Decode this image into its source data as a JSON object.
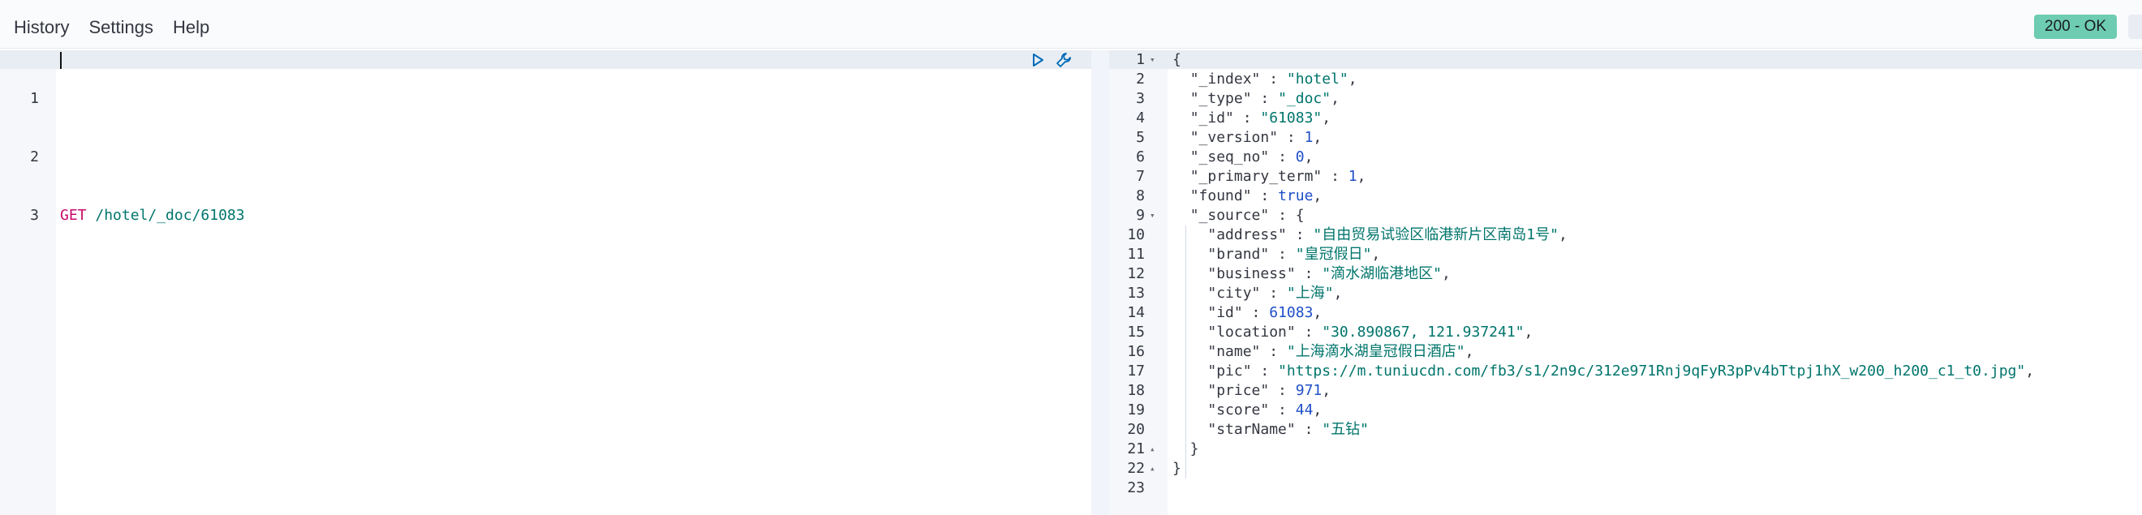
{
  "menu": {
    "history": "History",
    "settings": "Settings",
    "help": "Help"
  },
  "status": "200 - OK",
  "colors": {
    "status_bg": "#6dccb1",
    "method": "#c80a68",
    "string": "#00756c",
    "number": "#1f4fc8",
    "icon": "#006bb8"
  },
  "request": {
    "lines": [
      "",
      "",
      "GET /hotel/_doc/61083"
    ],
    "method": "GET",
    "path": "/hotel/_doc/61083",
    "icons": [
      "play-icon",
      "wrench-icon"
    ]
  },
  "response": {
    "line_numbers": [
      "1",
      "2",
      "3",
      "4",
      "5",
      "6",
      "7",
      "8",
      "9",
      "10",
      "11",
      "12",
      "13",
      "14",
      "15",
      "16",
      "17",
      "18",
      "19",
      "20",
      "21",
      "22",
      "23"
    ],
    "lines": [
      [
        {
          "t": "p",
          "v": "{"
        }
      ],
      [
        {
          "t": "p",
          "v": "  "
        },
        {
          "t": "k",
          "v": "\"_index\""
        },
        {
          "t": "p",
          "v": " : "
        },
        {
          "t": "s",
          "v": "\"hotel\""
        },
        {
          "t": "p",
          "v": ","
        }
      ],
      [
        {
          "t": "p",
          "v": "  "
        },
        {
          "t": "k",
          "v": "\"_type\""
        },
        {
          "t": "p",
          "v": " : "
        },
        {
          "t": "s",
          "v": "\"_doc\""
        },
        {
          "t": "p",
          "v": ","
        }
      ],
      [
        {
          "t": "p",
          "v": "  "
        },
        {
          "t": "k",
          "v": "\"_id\""
        },
        {
          "t": "p",
          "v": " : "
        },
        {
          "t": "s",
          "v": "\"61083\""
        },
        {
          "t": "p",
          "v": ","
        }
      ],
      [
        {
          "t": "p",
          "v": "  "
        },
        {
          "t": "k",
          "v": "\"_version\""
        },
        {
          "t": "p",
          "v": " : "
        },
        {
          "t": "n",
          "v": "1"
        },
        {
          "t": "p",
          "v": ","
        }
      ],
      [
        {
          "t": "p",
          "v": "  "
        },
        {
          "t": "k",
          "v": "\"_seq_no\""
        },
        {
          "t": "p",
          "v": " : "
        },
        {
          "t": "n",
          "v": "0"
        },
        {
          "t": "p",
          "v": ","
        }
      ],
      [
        {
          "t": "p",
          "v": "  "
        },
        {
          "t": "k",
          "v": "\"_primary_term\""
        },
        {
          "t": "p",
          "v": " : "
        },
        {
          "t": "n",
          "v": "1"
        },
        {
          "t": "p",
          "v": ","
        }
      ],
      [
        {
          "t": "p",
          "v": "  "
        },
        {
          "t": "k",
          "v": "\"found\""
        },
        {
          "t": "p",
          "v": " : "
        },
        {
          "t": "b",
          "v": "true"
        },
        {
          "t": "p",
          "v": ","
        }
      ],
      [
        {
          "t": "p",
          "v": "  "
        },
        {
          "t": "k",
          "v": "\"_source\""
        },
        {
          "t": "p",
          "v": " : {"
        }
      ],
      [
        {
          "t": "p",
          "v": "    "
        },
        {
          "t": "k",
          "v": "\"address\""
        },
        {
          "t": "p",
          "v": " : "
        },
        {
          "t": "s",
          "v": "\"自由贸易试验区临港新片区南岛1号\""
        },
        {
          "t": "p",
          "v": ","
        }
      ],
      [
        {
          "t": "p",
          "v": "    "
        },
        {
          "t": "k",
          "v": "\"brand\""
        },
        {
          "t": "p",
          "v": " : "
        },
        {
          "t": "s",
          "v": "\"皇冠假日\""
        },
        {
          "t": "p",
          "v": ","
        }
      ],
      [
        {
          "t": "p",
          "v": "    "
        },
        {
          "t": "k",
          "v": "\"business\""
        },
        {
          "t": "p",
          "v": " : "
        },
        {
          "t": "s",
          "v": "\"滴水湖临港地区\""
        },
        {
          "t": "p",
          "v": ","
        }
      ],
      [
        {
          "t": "p",
          "v": "    "
        },
        {
          "t": "k",
          "v": "\"city\""
        },
        {
          "t": "p",
          "v": " : "
        },
        {
          "t": "s",
          "v": "\"上海\""
        },
        {
          "t": "p",
          "v": ","
        }
      ],
      [
        {
          "t": "p",
          "v": "    "
        },
        {
          "t": "k",
          "v": "\"id\""
        },
        {
          "t": "p",
          "v": " : "
        },
        {
          "t": "n",
          "v": "61083"
        },
        {
          "t": "p",
          "v": ","
        }
      ],
      [
        {
          "t": "p",
          "v": "    "
        },
        {
          "t": "k",
          "v": "\"location\""
        },
        {
          "t": "p",
          "v": " : "
        },
        {
          "t": "s",
          "v": "\"30.890867, 121.937241\""
        },
        {
          "t": "p",
          "v": ","
        }
      ],
      [
        {
          "t": "p",
          "v": "    "
        },
        {
          "t": "k",
          "v": "\"name\""
        },
        {
          "t": "p",
          "v": " : "
        },
        {
          "t": "s",
          "v": "\"上海滴水湖皇冠假日酒店\""
        },
        {
          "t": "p",
          "v": ","
        }
      ],
      [
        {
          "t": "p",
          "v": "    "
        },
        {
          "t": "k",
          "v": "\"pic\""
        },
        {
          "t": "p",
          "v": " : "
        },
        {
          "t": "s",
          "v": "\"https://m.tuniucdn.com/fb3/s1/2n9c/312e971Rnj9qFyR3pPv4bTtpj1hX_w200_h200_c1_t0.jpg\""
        },
        {
          "t": "p",
          "v": ","
        }
      ],
      [
        {
          "t": "p",
          "v": "    "
        },
        {
          "t": "k",
          "v": "\"price\""
        },
        {
          "t": "p",
          "v": " : "
        },
        {
          "t": "n",
          "v": "971"
        },
        {
          "t": "p",
          "v": ","
        }
      ],
      [
        {
          "t": "p",
          "v": "    "
        },
        {
          "t": "k",
          "v": "\"score\""
        },
        {
          "t": "p",
          "v": " : "
        },
        {
          "t": "n",
          "v": "44"
        },
        {
          "t": "p",
          "v": ","
        }
      ],
      [
        {
          "t": "p",
          "v": "    "
        },
        {
          "t": "k",
          "v": "\"starName\""
        },
        {
          "t": "p",
          "v": " : "
        },
        {
          "t": "s",
          "v": "\"五钻\""
        }
      ],
      [
        {
          "t": "p",
          "v": "  }"
        }
      ],
      [
        {
          "t": "p",
          "v": "}"
        }
      ],
      [
        {
          "t": "p",
          "v": ""
        }
      ]
    ],
    "folds": {
      "1": "▾",
      "9": "▾",
      "21": "▴",
      "22": "▴"
    }
  }
}
